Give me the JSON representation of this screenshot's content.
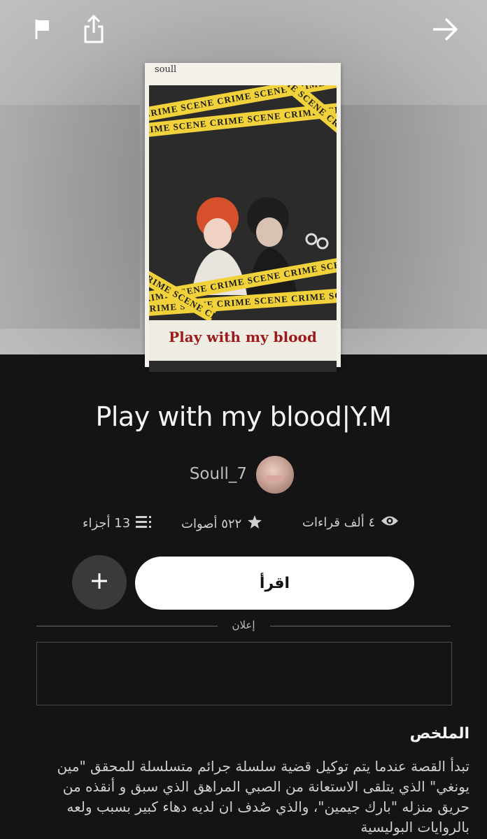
{
  "story": {
    "title": "Play with my blood|Y.M",
    "author": "Soull_7",
    "cover": {
      "top_tag": "soull",
      "tape_text": "CRIME SCENE",
      "caption": "Play with my blood"
    }
  },
  "stats": {
    "reads": "٤ ألف قراءات",
    "votes": "٥٢٢ أصوات",
    "parts": "13 أجزاء"
  },
  "actions": {
    "read_label": "اقرأ"
  },
  "ad": {
    "label": "إعلان"
  },
  "summary": {
    "heading": "الملخص",
    "text": "تبدأ القصة عندما يتم توكيل قضية سلسلة جرائم متسلسلة للمحقق \"مين يونغي\" الذي يتلقى الاستعانة من الصبي المراهق الذي سبق و أنقذه من حريق منزله \"بارك جيمين\"، والذي صُدف ان لديه دهاء كبير بسبب ولعه بالروايات البوليسية"
  },
  "icons": {
    "flag": "flag-icon",
    "share": "share-icon",
    "forward": "arrow-right-icon",
    "reads": "eye-icon",
    "votes": "star-icon",
    "parts": "list-icon",
    "plus": "plus-icon"
  },
  "colors": {
    "background": "#141414",
    "button": "#ffffff",
    "tape": "#f1d23a",
    "caption": "#9b1b1b"
  }
}
